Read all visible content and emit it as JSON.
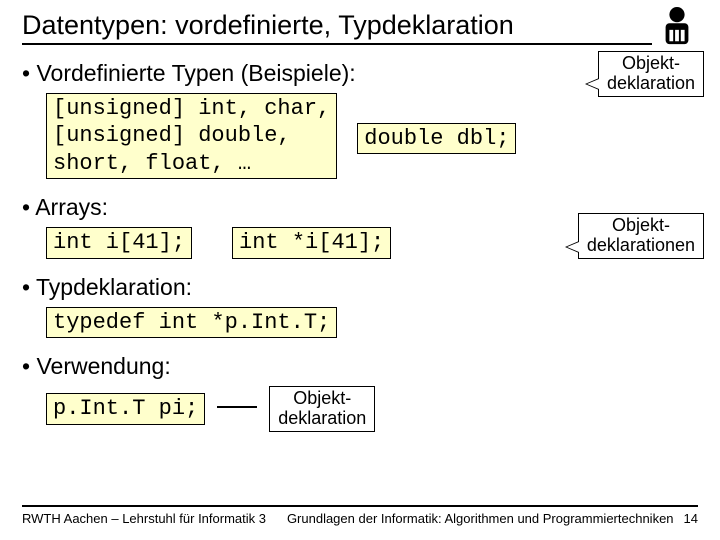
{
  "title": "Datentypen: vordefinierte, Typdeklaration",
  "sections": {
    "predef": {
      "heading": "Vordefinierte Typen (Beispiele):",
      "code": "[unsigned] int, char,\n[unsigned] double,\nshort, float, …",
      "example": "double dbl;",
      "callout": "Objekt-\ndeklaration"
    },
    "arrays": {
      "heading": "Arrays:",
      "code1": "int i[41];",
      "code2": "int *i[41];",
      "callout": "Objekt-\ndeklarationen"
    },
    "typedecl": {
      "heading": "Typdeklaration:",
      "code": "typedef int *p.Int.T;"
    },
    "usage": {
      "heading": "Verwendung:",
      "code": "p.Int.T pi;",
      "callout": "Objekt-\ndeklaration"
    }
  },
  "footer": {
    "left": "RWTH Aachen – Lehrstuhl für Informatik 3",
    "right": "Grundlagen der Informatik: Algorithmen und Programmiertechniken",
    "page": "14"
  }
}
